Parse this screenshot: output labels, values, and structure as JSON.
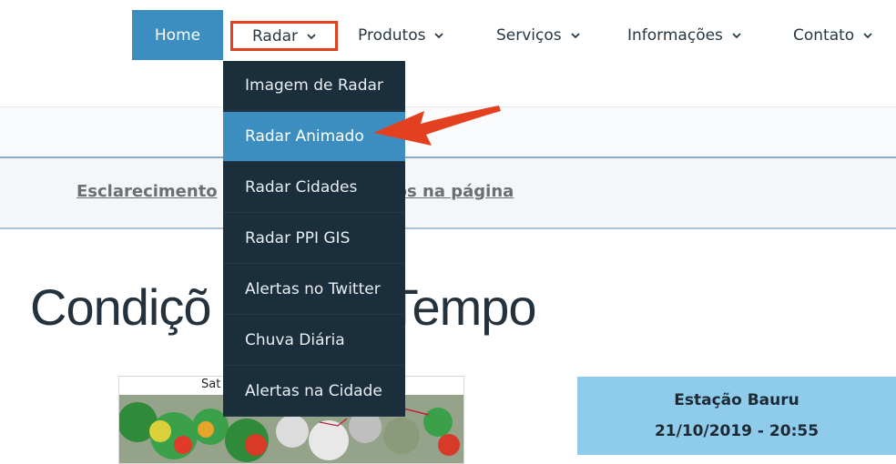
{
  "nav": {
    "items": [
      {
        "label": "Home"
      },
      {
        "label": "Radar"
      },
      {
        "label": "Produtos"
      },
      {
        "label": "Serviços"
      },
      {
        "label": "Informações"
      },
      {
        "label": "Contato"
      }
    ]
  },
  "radar_menu": {
    "items": [
      {
        "label": "Imagem de Radar"
      },
      {
        "label": "Radar Animado"
      },
      {
        "label": "Radar Cidades"
      },
      {
        "label": "Radar PPI GIS"
      },
      {
        "label": "Alertas no Twitter"
      },
      {
        "label": "Chuva Diária"
      },
      {
        "label": "Alertas na Cidade"
      }
    ]
  },
  "notice": {
    "left": "Esclarecimento",
    "right": "os na página"
  },
  "heading": {
    "left": "Condiçõ",
    "right": "Tempo"
  },
  "satellite": {
    "caption": "Sat"
  },
  "station": {
    "name": "Estação Bauru",
    "datetime": "21/10/2019 - 20:55"
  },
  "colors": {
    "accent": "#3d8ec0",
    "menu_bg": "#1a2e3c",
    "highlight": "#e3401f",
    "station_bg": "#8fcbea"
  }
}
